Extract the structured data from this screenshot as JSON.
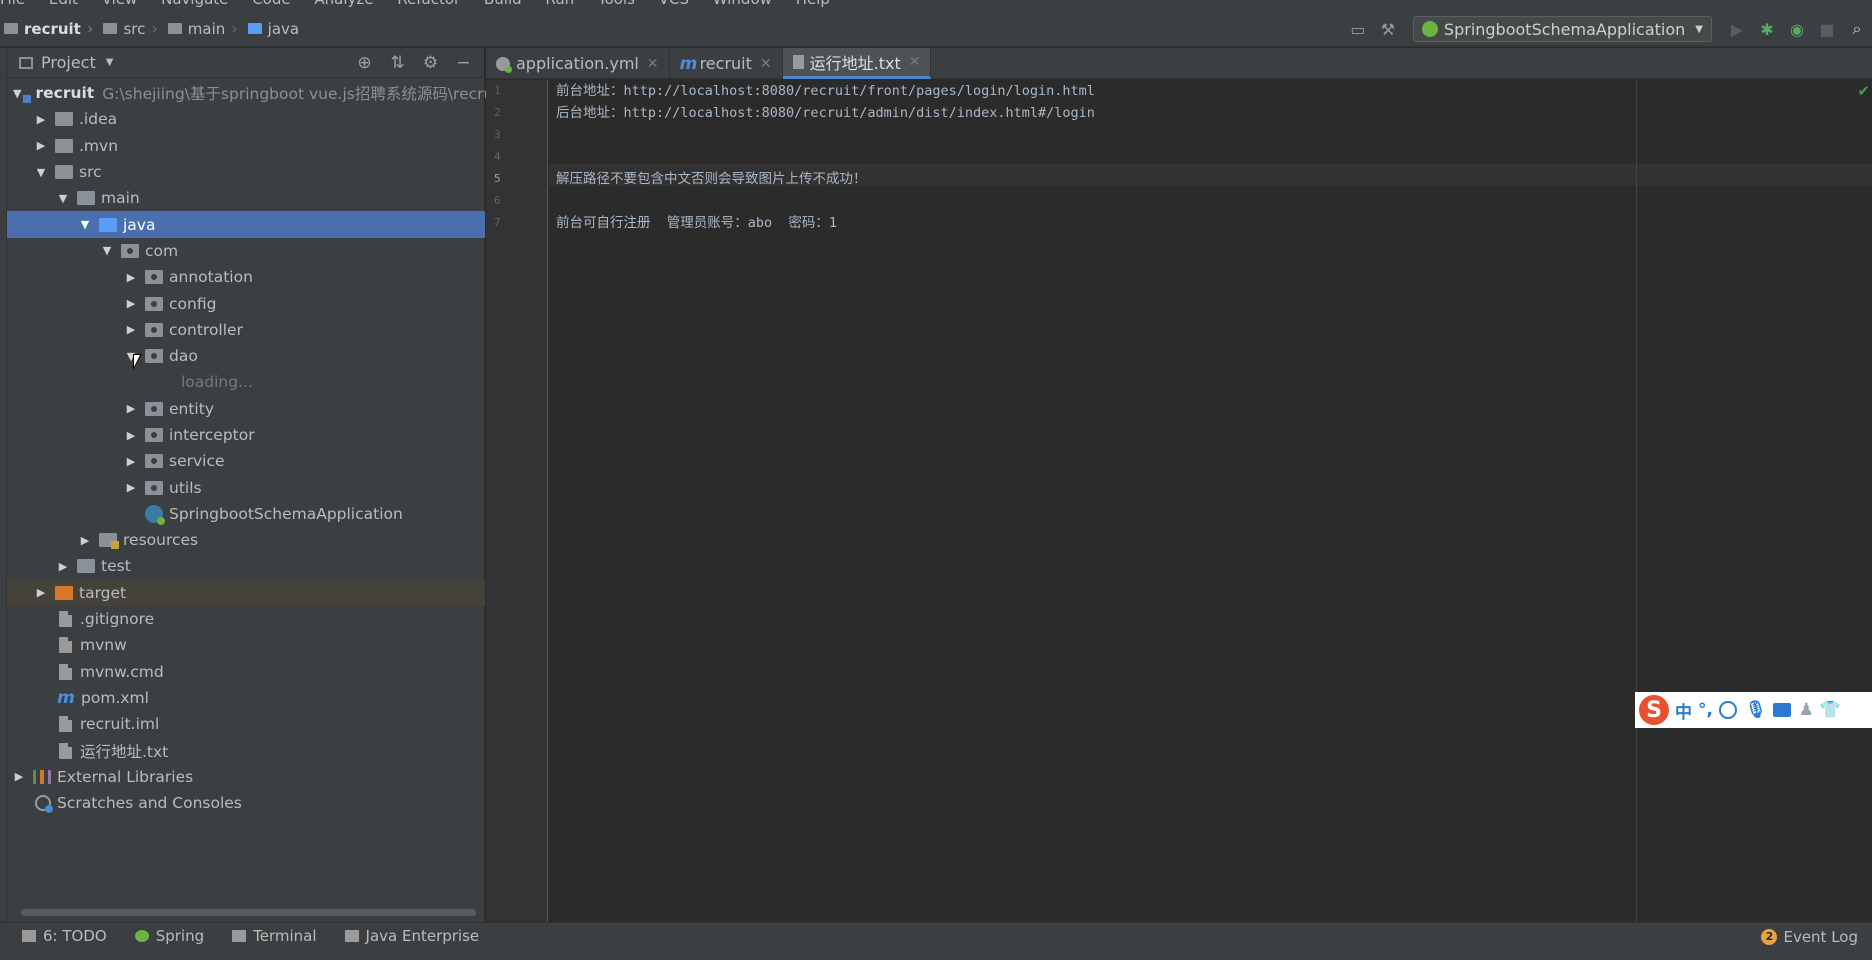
{
  "menu": [
    "File",
    "Edit",
    "View",
    "Navigate",
    "Code",
    "Analyze",
    "Refactor",
    "Build",
    "Run",
    "Tools",
    "VCS",
    "Window",
    "Help"
  ],
  "breadcrumb": [
    "recruit",
    "src",
    "main",
    "java"
  ],
  "run_config": "SpringbootSchemaApplication",
  "project_panel": {
    "title": "Project"
  },
  "tree": {
    "root_name": "recruit",
    "root_path": "G:\\shejiing\\基于springboot vue.js招聘系统源码\\recru",
    "idea": ".idea",
    "mvn": ".mvn",
    "src": "src",
    "main": "main",
    "java": "java",
    "com": "com",
    "annotation": "annotation",
    "config": "config",
    "controller": "controller",
    "dao": "dao",
    "loading": "loading...",
    "entity": "entity",
    "interceptor": "interceptor",
    "service": "service",
    "utils": "utils",
    "app": "SpringbootSchemaApplication",
    "resources": "resources",
    "test": "test",
    "target": "target",
    "gitignore": ".gitignore",
    "mvnw": "mvnw",
    "mvnw_cmd": "mvnw.cmd",
    "pom": "pom.xml",
    "iml": "recruit.iml",
    "txt": "运行地址.txt",
    "ext_libs": "External Libraries",
    "scratches": "Scratches and Consoles"
  },
  "tabs": [
    "application.yml",
    "recruit",
    "运行地址.txt"
  ],
  "editor": {
    "line_numbers": [
      "1",
      "2",
      "3",
      "4",
      "5",
      "6",
      "7"
    ],
    "lines": [
      "前台地址：http://localhost:8080/recruit/front/pages/login/login.html",
      "后台地址：http://localhost:8080/recruit/admin/dist/index.html#/login",
      "",
      "",
      "解压路径不要包含中文否则会导致图片上传不成功！",
      "",
      "前台可自行注册  管理员账号：abo  密码：1"
    ]
  },
  "ime": {
    "mode": "中",
    "punct": "°,"
  },
  "bottom_tools": {
    "todo": "6: TODO",
    "spring": "Spring",
    "terminal": "Terminal",
    "java_ee": "Java Enterprise",
    "event_log": "Event Log",
    "event_count": "2"
  }
}
